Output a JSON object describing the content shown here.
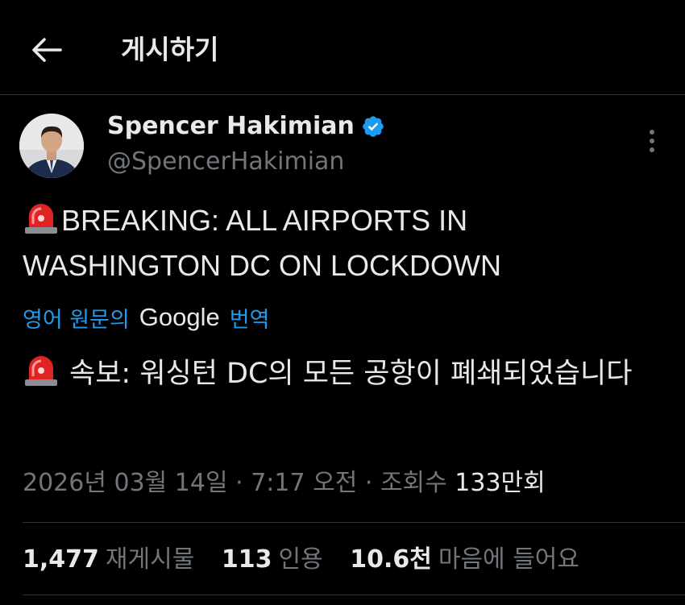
{
  "header": {
    "back_icon": "arrow-left-icon",
    "title": "게시하기"
  },
  "post": {
    "author": {
      "name": "Spencer Hakimian",
      "handle": "@SpencerHakimian",
      "verified_icon": "verified-badge-icon",
      "avatar_icon": "avatar-photo"
    },
    "more_icon": "more-vertical-icon",
    "emoji_icon": "police-siren-light-icon",
    "text": "BREAKING: ALL AIRPORTS IN WASHINGTON DC ON LOCKDOWN",
    "translate": {
      "prefix": "영어 원문의",
      "brand": "Google",
      "suffix": "번역"
    },
    "translation": "속보: 워싱턴 DC의 모든 공항이 폐쇄되었습니다",
    "meta": {
      "date": "2026년 03월 14일",
      "time": "7:17 오전",
      "views_label": "조회수",
      "views_count": "133만회"
    },
    "stats": {
      "reposts": "1,477",
      "reposts_label": "재게시물",
      "quotes": "113",
      "quotes_label": "인용",
      "likes": "10.6천",
      "likes_label": "마음에 들어요"
    }
  },
  "colors": {
    "background": "#000000",
    "text": "#e7e9ea",
    "muted": "#71767b",
    "link": "#1d9bf0",
    "verified": "#1d9bf0",
    "divider": "#2f3336"
  }
}
